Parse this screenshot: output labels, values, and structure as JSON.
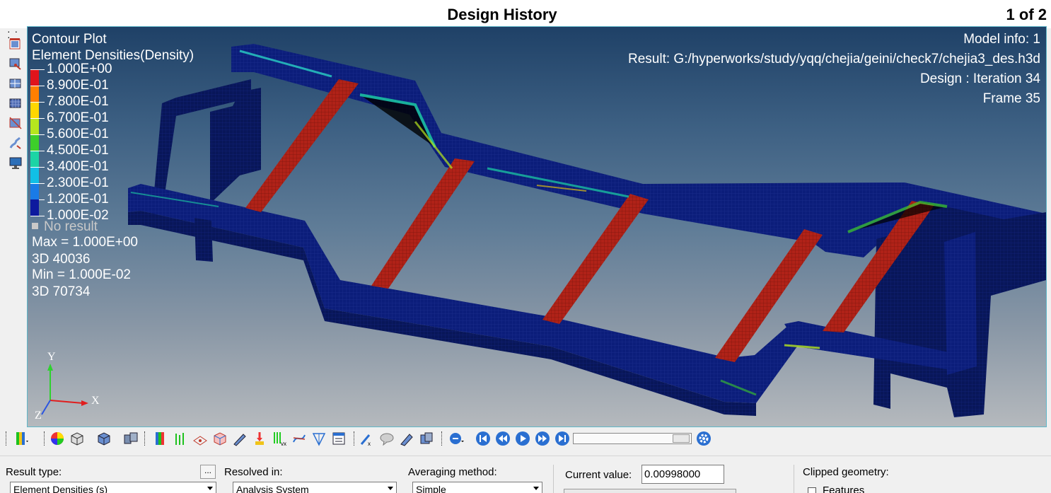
{
  "window": {
    "title": "Design History",
    "page_count": "1 of 2"
  },
  "viewport": {
    "plot_type": "Contour Plot",
    "result_name": "Element Densities(Density)",
    "model_info": "Model info: 1",
    "result_path": "Result: G:/hyperworks/study/yqq/chejia/geini/check7/chejia3_des.h3d",
    "design_iteration": "Design : Iteration 34",
    "frame": "Frame 35",
    "legend": {
      "levels": [
        {
          "label": "1.000E+00",
          "color": "#e0141c"
        },
        {
          "label": "8.900E-01",
          "color": "#ff7f00"
        },
        {
          "label": "7.800E-01",
          "color": "#ffd700"
        },
        {
          "label": "6.700E-01",
          "color": "#b6e61e"
        },
        {
          "label": "5.600E-01",
          "color": "#3dcf2a"
        },
        {
          "label": "4.500E-01",
          "color": "#1cd4a5"
        },
        {
          "label": "3.400E-01",
          "color": "#11bfe6"
        },
        {
          "label": "2.300E-01",
          "color": "#1a7be6"
        },
        {
          "label": "1.200E-01",
          "color": "#1639d1"
        },
        {
          "label": "1.000E-02",
          "color": "#0d1a9e"
        }
      ],
      "no_result": "No result"
    },
    "max_text": "Max = 1.000E+00",
    "max_element": "3D 40036",
    "min_text": "Min = 1.000E-02",
    "min_element": "3D 70734",
    "axes": {
      "y": "Y",
      "x": "X",
      "z": "Z"
    }
  },
  "left_toolbar": {
    "icons": [
      "contour-icon",
      "contour-edit-icon",
      "iso-surface-icon",
      "mesh-view-icon",
      "clip-icon",
      "deformed-shape-icon",
      "monitor-icon"
    ]
  },
  "bottom_toolbar": {
    "icons": [
      "contour-legend-icon",
      "color-wheel-icon",
      "mesh-cube-icon",
      "shaded-cube-icon",
      "elements-icon",
      "contour-bar-icon",
      "vector-icon",
      "iso-icon",
      "wireframe-cube-icon",
      "measure-icon",
      "marker-icon",
      "probe-icon",
      "tracking-icon",
      "curve-icon",
      "notes-icon",
      "query-icon",
      "comment-icon",
      "section-icon",
      "section-cut-icon",
      "animation-mode-icon",
      "first-frame-icon",
      "previous-frame-icon",
      "play-icon",
      "next-frame-icon",
      "last-frame-icon",
      "settings-icon"
    ]
  },
  "panel": {
    "result_type_label": "Result type:",
    "result_type_value": "Element Densities (s)",
    "resolved_in_label": "Resolved in:",
    "resolved_in_value": "Analysis System",
    "averaging_label": "Averaging method:",
    "averaging_value": "Simple",
    "current_value_label": "Current value:",
    "current_value": "0.00998000",
    "clipped_label": "Clipped geometry:",
    "features_label": "Features",
    "browse_label": "..."
  },
  "colors": {
    "frame_blue": "#0b1d7a",
    "rib_red": "#b02218",
    "viewport_border": "#5fb7c9"
  }
}
